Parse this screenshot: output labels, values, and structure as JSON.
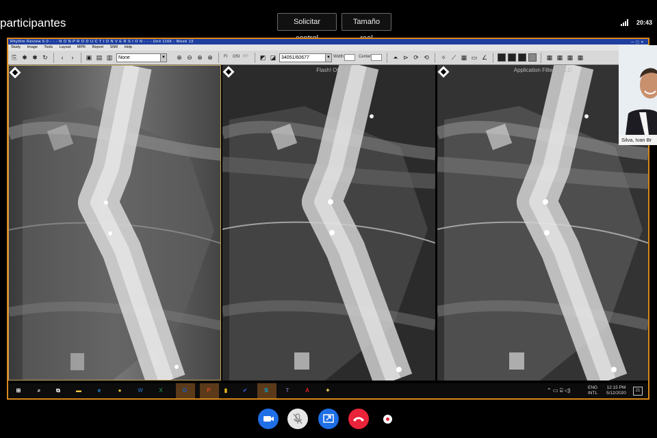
{
  "meeting": {
    "participants_title": "participantes",
    "request_control_label": "Solicitar control",
    "actual_size_label": "Tamaño real",
    "clock": "20:43",
    "webcam_name": "Silva, Ivan Br"
  },
  "app": {
    "title": "Rhythm Review 6.0 - - - N O N  P R O D U C T I O N  V E R S I O N - - -  Unit 1166 - Week 13",
    "menu": [
      "Study",
      "Image",
      "Tools",
      "Layout",
      "MPR",
      "Report",
      "SNR",
      "Help"
    ],
    "toolbar": {
      "filter_select": "None",
      "f_label": "FI",
      "osi_label": "OSI",
      "rf_label": "RF",
      "window_select": "34051/60677",
      "width_label": "Width",
      "center_label": "Center"
    },
    "panels": [
      {
        "label": ""
      },
      {
        "label": "Flash! OG"
      },
      {
        "label": "Application Filter WELD"
      }
    ]
  },
  "taskbar": {
    "apps": [
      {
        "name": "windows-start-icon",
        "glyph": "⊞",
        "color": "#ffffff"
      },
      {
        "name": "search-icon",
        "glyph": "⌕",
        "color": "#ffffff"
      },
      {
        "name": "task-view-icon",
        "glyph": "⧉",
        "color": "#ffffff"
      },
      {
        "name": "file-explorer-icon",
        "glyph": "▬",
        "color": "#f4c542"
      },
      {
        "name": "edge-icon",
        "glyph": "e",
        "color": "#2c8be8"
      },
      {
        "name": "chrome-icon",
        "glyph": "●",
        "color": "#e8c72a"
      },
      {
        "name": "word-icon",
        "glyph": "W",
        "color": "#2b5797"
      },
      {
        "name": "excel-icon",
        "glyph": "X",
        "color": "#1e7145"
      },
      {
        "name": "outlook-icon",
        "glyph": "O",
        "color": "#0a64c8"
      },
      {
        "name": "powerpoint-icon",
        "glyph": "P",
        "color": "#d24726"
      },
      {
        "name": "app-icon-yellow",
        "glyph": "▮",
        "color": "#e6b81d"
      },
      {
        "name": "app-icon-check",
        "glyph": "✔",
        "color": "#3a55c8"
      },
      {
        "name": "skype-icon",
        "glyph": "S",
        "color": "#00aff0"
      },
      {
        "name": "teams-icon",
        "glyph": "T",
        "color": "#6264a7"
      },
      {
        "name": "acrobat-icon",
        "glyph": "A",
        "color": "#e02020"
      },
      {
        "name": "lightbulb-icon",
        "glyph": "✦",
        "color": "#f2d15c"
      }
    ],
    "lang_top": "ENG",
    "lang_bottom": "INTL",
    "time": "12:15 PM",
    "date": "5/12/2020",
    "notifications": "21"
  },
  "colors": {
    "share_border": "#d9881d",
    "app_titlebar": "#1f3fa0",
    "call_blue": "#1f6fe6",
    "call_red": "#e8233a"
  }
}
